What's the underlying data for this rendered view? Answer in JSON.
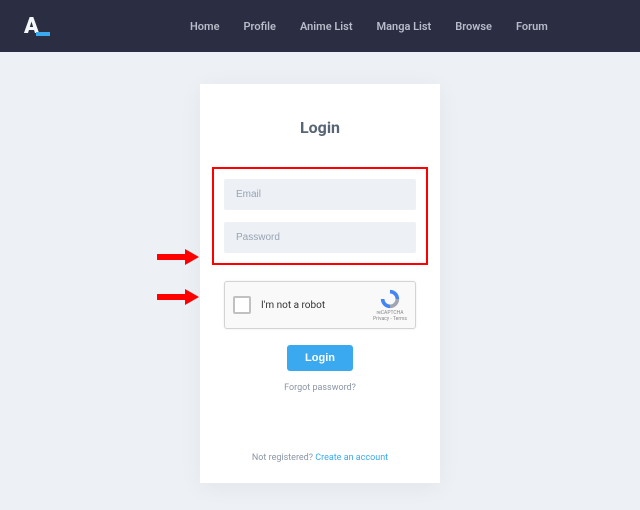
{
  "nav": {
    "items": [
      "Home",
      "Profile",
      "Anime List",
      "Manga List",
      "Browse",
      "Forum"
    ]
  },
  "login": {
    "title": "Login",
    "email_placeholder": "Email",
    "password_placeholder": "Password",
    "recaptcha_label": "I'm not a robot",
    "recaptcha_brand": "reCAPTCHA",
    "recaptcha_terms": "Privacy - Terms",
    "button": "Login",
    "forgot": "Forgot password?",
    "not_registered": "Not registered? ",
    "create": "Create an account"
  }
}
